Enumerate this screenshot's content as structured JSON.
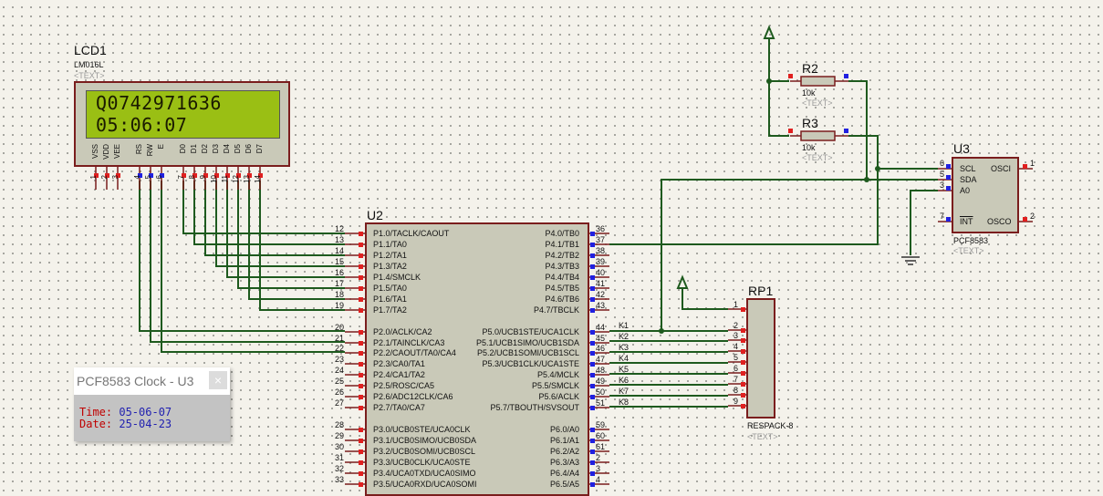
{
  "lcd1": {
    "ref": "LCD1",
    "part": "LM016L",
    "text_tag": "<TEXT>",
    "line1": "Q0742971636",
    "line2": "05:06:07",
    "pin_labels": [
      "VSS",
      "VDD",
      "VEE",
      "RS",
      "RW",
      "E",
      "D0",
      "D1",
      "D2",
      "D3",
      "D4",
      "D5",
      "D6",
      "D7"
    ],
    "pin_numbers": [
      "1",
      "2",
      "3",
      "4",
      "5",
      "6",
      "7",
      "8",
      "9",
      "10",
      "11",
      "12",
      "13",
      "14"
    ]
  },
  "u2": {
    "ref": "U2",
    "left_pins": [
      {
        "num": "12",
        "name": "P1.0/TACLK/CAOUT"
      },
      {
        "num": "13",
        "name": "P1.1/TA0"
      },
      {
        "num": "14",
        "name": "P1.2/TA1"
      },
      {
        "num": "15",
        "name": "P1.3/TA2"
      },
      {
        "num": "16",
        "name": "P1.4/SMCLK"
      },
      {
        "num": "17",
        "name": "P1.5/TA0"
      },
      {
        "num": "18",
        "name": "P1.6/TA1"
      },
      {
        "num": "19",
        "name": "P1.7/TA2"
      },
      {
        "num": "20",
        "name": "P2.0/ACLK/CA2"
      },
      {
        "num": "21",
        "name": "P2.1/TAINCLK/CA3"
      },
      {
        "num": "22",
        "name": "P2.2/CAOUT/TA0/CA4"
      },
      {
        "num": "23",
        "name": "P2.3/CA0/TA1"
      },
      {
        "num": "24",
        "name": "P2.4/CA1/TA2"
      },
      {
        "num": "25",
        "name": "P2.5/ROSC/CA5"
      },
      {
        "num": "26",
        "name": "P2.6/ADC12CLK/CA6"
      },
      {
        "num": "27",
        "name": "P2.7/TA0/CA7"
      },
      {
        "num": "28",
        "name": "P3.0/UCB0STE/UCA0CLK"
      },
      {
        "num": "29",
        "name": "P3.1/UCB0SIMO/UCB0SDA"
      },
      {
        "num": "30",
        "name": "P3.2/UCB0SOMI/UCB0SCL"
      },
      {
        "num": "31",
        "name": "P3.3/UCB0CLK/UCA0STE"
      },
      {
        "num": "32",
        "name": "P3.4/UCA0TXD/UCA0SIMO"
      },
      {
        "num": "33",
        "name": "P3.5/UCA0RXD/UCA0SOMI"
      }
    ],
    "right_pins": [
      {
        "num": "36",
        "name": "P4.0/TB0"
      },
      {
        "num": "37",
        "name": "P4.1/TB1"
      },
      {
        "num": "38",
        "name": "P4.2/TB2"
      },
      {
        "num": "39",
        "name": "P4.3/TB3"
      },
      {
        "num": "40",
        "name": "P4.4/TB4"
      },
      {
        "num": "41",
        "name": "P4.5/TB5"
      },
      {
        "num": "42",
        "name": "P4.6/TB6"
      },
      {
        "num": "43",
        "name": "P4.7/TBCLK"
      },
      {
        "num": "44",
        "name": "P5.0/UCB1STE/UCA1CLK"
      },
      {
        "num": "45",
        "name": "P5.1/UCB1SIMO/UCB1SDA"
      },
      {
        "num": "46",
        "name": "P5.2/UCB1SOMI/UCB1SCL"
      },
      {
        "num": "47",
        "name": "P5.3/UCB1CLK/UCA1STE"
      },
      {
        "num": "48",
        "name": "P5.4/MCLK"
      },
      {
        "num": "49",
        "name": "P5.5/SMCLK"
      },
      {
        "num": "50",
        "name": "P5.6/ACLK"
      },
      {
        "num": "51",
        "name": "P5.7/TBOUTH/SVSOUT"
      },
      {
        "num": "59",
        "name": "P6.0/A0"
      },
      {
        "num": "60",
        "name": "P6.1/A1"
      },
      {
        "num": "61",
        "name": "P6.2/A2"
      },
      {
        "num": "2",
        "name": "P6.3/A3"
      },
      {
        "num": "3",
        "name": "P6.4/A4"
      },
      {
        "num": "4",
        "name": "P6.5/A5"
      }
    ],
    "net_labels": [
      "K1",
      "K2",
      "K3",
      "K4",
      "K5",
      "K6",
      "K7",
      "K8"
    ]
  },
  "rp1": {
    "ref": "RP1",
    "part": "RESPACK-8",
    "text_tag": "<TEXT>",
    "pins": [
      "1",
      "2",
      "3",
      "4",
      "5",
      "6",
      "7",
      "8",
      "9"
    ]
  },
  "r2": {
    "ref": "R2",
    "value": "10k",
    "text_tag": "<TEXT>"
  },
  "r3": {
    "ref": "R3",
    "value": "10k",
    "text_tag": "<TEXT>"
  },
  "u3": {
    "ref": "U3",
    "part": "PCF8583",
    "text_tag": "<TEXT>",
    "pins_left": [
      {
        "num": "6",
        "name": "SCL"
      },
      {
        "num": "5",
        "name": "SDA"
      },
      {
        "num": "3",
        "name": "A0"
      },
      {
        "num": "7",
        "name": "INT"
      }
    ],
    "pins_right": [
      {
        "num": "1",
        "name": "OSCI"
      },
      {
        "num": "2",
        "name": "OSCO"
      }
    ]
  },
  "clock_window": {
    "title": "PCF8583 Clock - U3",
    "close_glyph": "×",
    "time_label": "Time:",
    "time_value": "05-06-07",
    "date_label": "Date:",
    "date_value": "25-04-23"
  },
  "colors": {
    "wire": "#1e5a1e",
    "body_fill": "#c9c9b8",
    "body_border": "#7a1d1d",
    "lcd_green": "#9abf14",
    "pin_red": "#e02020",
    "pin_blue": "#2020e0"
  }
}
